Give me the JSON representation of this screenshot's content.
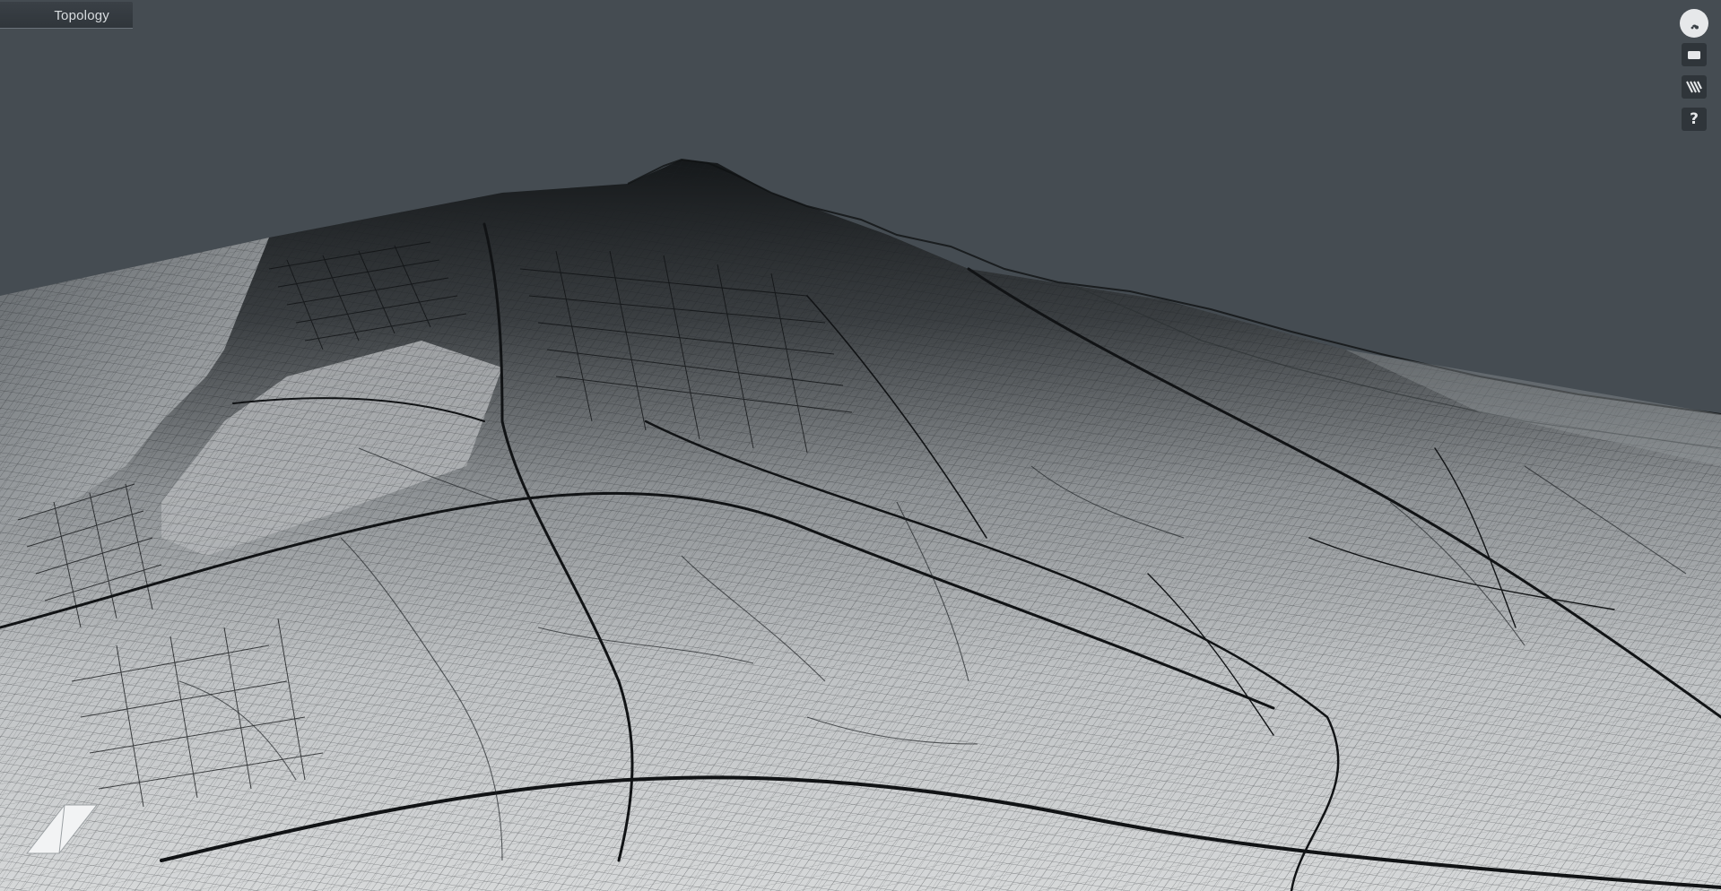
{
  "window": {
    "title": "Topology"
  },
  "toolbar": {
    "buttons": [
      {
        "icon": "globe-icon",
        "name": "view-globe-button"
      },
      {
        "icon": "camera-icon",
        "name": "camera-button"
      },
      {
        "icon": "layers-icon",
        "name": "layers-button"
      },
      {
        "label": "?",
        "icon": "help-icon",
        "name": "help-button"
      }
    ]
  },
  "colors": {
    "background": "#454c52",
    "terrain_light": "#cfd2d4",
    "terrain_dark": "#1c1f22",
    "road": "#101214"
  }
}
